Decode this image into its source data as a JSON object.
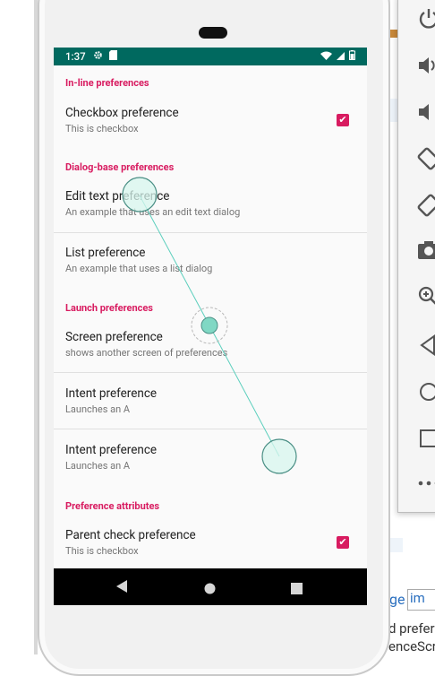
{
  "host_page": {
    "link_fragment": "ge",
    "image_placeholder": "im",
    "text_line_1": "d prefer",
    "text_line_2": "enceScr"
  },
  "toolbar": {
    "icons": [
      "power-icon",
      "volume-up-icon",
      "volume-down-icon",
      "rotate-left-icon",
      "rotate-right-icon",
      "camera-icon",
      "zoom-in-icon",
      "back-icon",
      "home-icon",
      "overview-icon",
      "more-icon"
    ]
  },
  "status_bar": {
    "time": "1:37"
  },
  "screen": {
    "categories": {
      "inline": "In-line preferences",
      "dialog": "Dialog-base preferences",
      "launch": "Launch preferences",
      "attributes": "Preference attributes"
    },
    "prefs": {
      "checkbox": {
        "title": "Checkbox preference",
        "summary": "This is checkbox",
        "checked": true
      },
      "edit_text": {
        "title": "Edit text preference",
        "summary": "An example that uses an edit text dialog"
      },
      "list": {
        "title": "List preference",
        "summary": "An example that uses a list dialog"
      },
      "screen": {
        "title": "Screen preference",
        "summary": "shows another screen of preferences"
      },
      "intent_1": {
        "title": "Intent preference",
        "summary": "Launches an A"
      },
      "intent_2": {
        "title": "Intent preference",
        "summary": "Launches an A"
      },
      "parent_check": {
        "title": "Parent check preference",
        "summary": "This is checkbox",
        "checked": true
      }
    }
  },
  "colors": {
    "status_bar": "#00695f",
    "accent": "#d81b60",
    "touch_indicator": "#80d8c4"
  }
}
